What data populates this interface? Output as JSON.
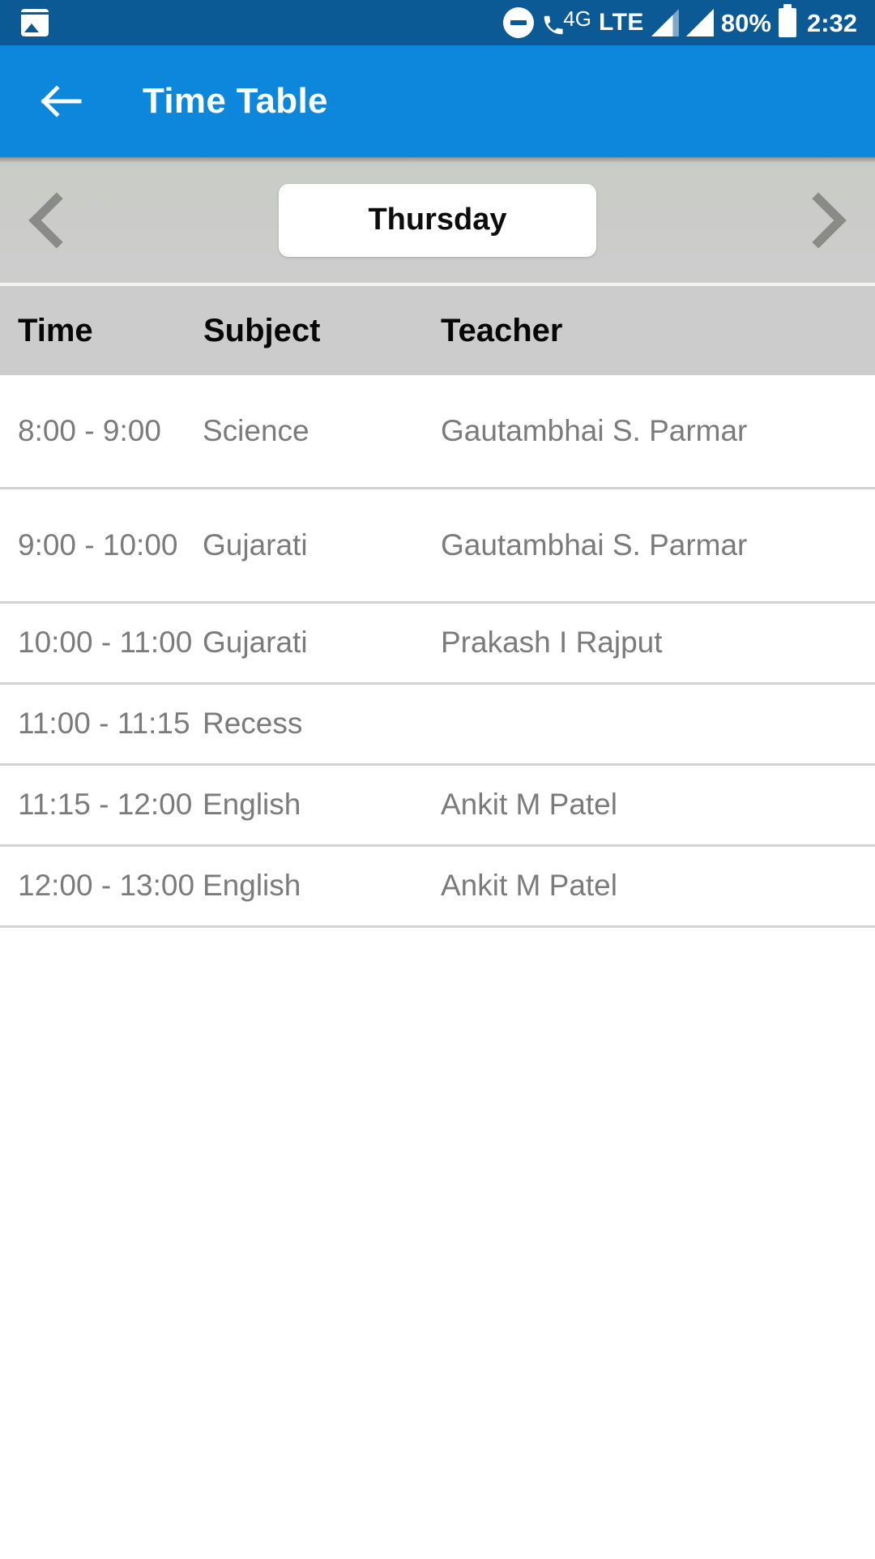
{
  "status_bar": {
    "background": "#0B5A96",
    "gallery_icon": "gallery-icon",
    "dnd_icon": "do-not-disturb-icon",
    "call_icon": "phone-handset-icon",
    "network_label": "4G",
    "lte_label": "LTE",
    "signal_icon_1": "signal-bars-icon",
    "signal_icon_2": "signal-bars-icon",
    "battery_percent": "80%",
    "battery_icon": "battery-icon",
    "time": "2:32"
  },
  "app_bar": {
    "background": "#0C87DC",
    "back_icon": "back-arrow-icon",
    "title": "Time Table"
  },
  "day_selector": {
    "background": "#cdcdcd",
    "prev_icon": "chevron-left-icon",
    "next_icon": "chevron-right-icon",
    "selected_day": "Thursday"
  },
  "table": {
    "header_background": "#cccccc",
    "columns": [
      "Time",
      "Subject",
      "Teacher"
    ],
    "rows": [
      {
        "time": "8:00 - 9:00",
        "subject": "Science",
        "teacher": "Gautambhai S. Parmar"
      },
      {
        "time": "9:00 - 10:00",
        "subject": "Gujarati",
        "teacher": "Gautambhai S. Parmar"
      },
      {
        "time": "10:00 - 11:00",
        "subject": "Gujarati",
        "teacher": "Prakash I Rajput"
      },
      {
        "time": "11:00 - 11:15",
        "subject": "Recess",
        "teacher": ""
      },
      {
        "time": "11:15 - 12:00",
        "subject": "English",
        "teacher": "Ankit M Patel"
      },
      {
        "time": "12:00 - 13:00",
        "subject": "English",
        "teacher": "Ankit M Patel"
      }
    ]
  }
}
